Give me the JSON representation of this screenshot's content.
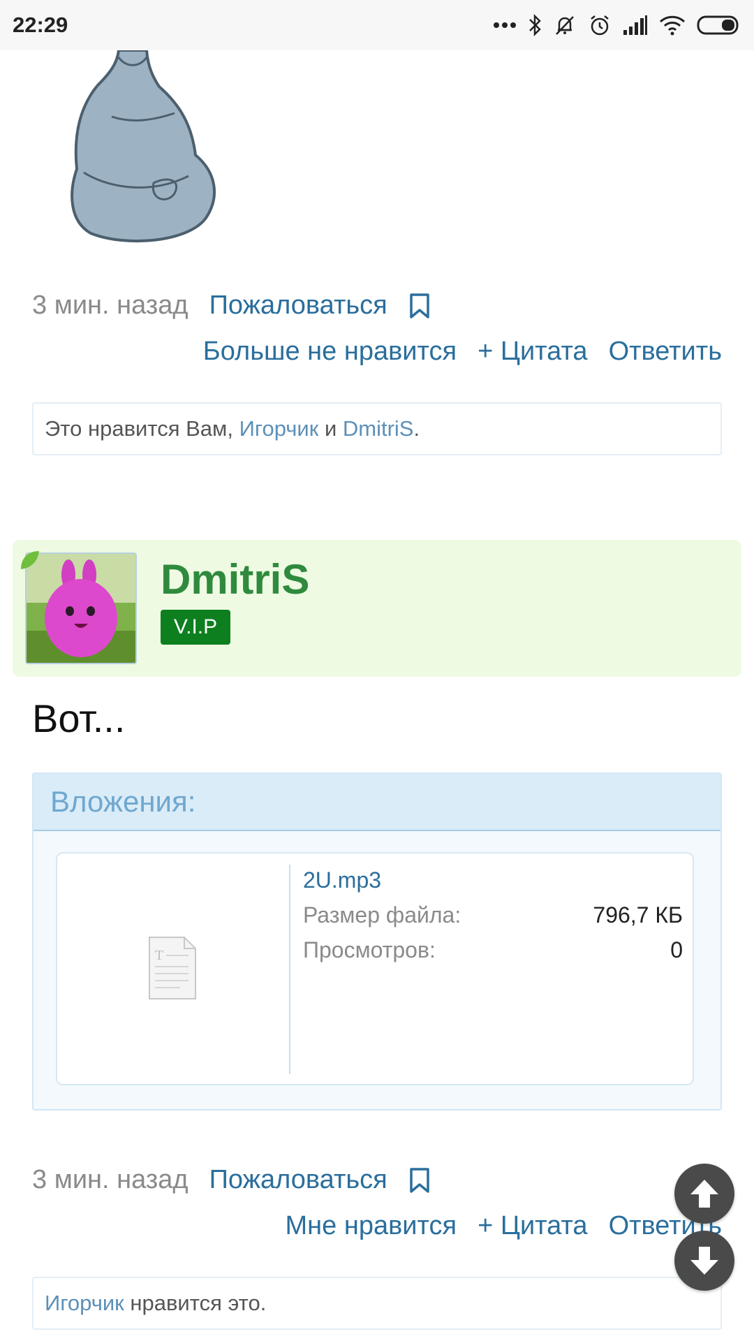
{
  "status_bar": {
    "time": "22:29",
    "icons": [
      "more-icon",
      "bluetooth-icon",
      "mute-icon",
      "alarm-icon",
      "signal-icon",
      "wifi-icon",
      "battery-icon"
    ]
  },
  "post1": {
    "time": "3 мин. назад",
    "report": "Пожаловаться",
    "actions": [
      "Больше не нравится",
      "+ Цитата",
      "Ответить"
    ],
    "likes": {
      "prefix": "Это нравится Вам, ",
      "user1": "Игорчик",
      "sep": " и ",
      "user2": "DmitriS",
      "suffix": "."
    }
  },
  "post2": {
    "author": "DmitriS",
    "badge": "V.I.P",
    "body": "Вот...",
    "attachments": {
      "title": "Вложения:",
      "file_name": "2U.mp3",
      "size_label": "Размер файла:",
      "size_value": "796,7 КБ",
      "views_label": "Просмотров:",
      "views_value": "0"
    },
    "time": "3 мин. назад",
    "report": "Пожаловаться",
    "actions": [
      "Мне нравится",
      "+ Цитата",
      "Ответить"
    ],
    "likes": {
      "user": "Игорчик",
      "suffix": " нравится это."
    }
  },
  "colors": {
    "link": "#2a6e9c",
    "author_green": "#2f8a3e",
    "vip_badge": "#0d7f1f",
    "header_bg": "#eefbe2",
    "attach_head_bg": "#d9ecf8"
  }
}
